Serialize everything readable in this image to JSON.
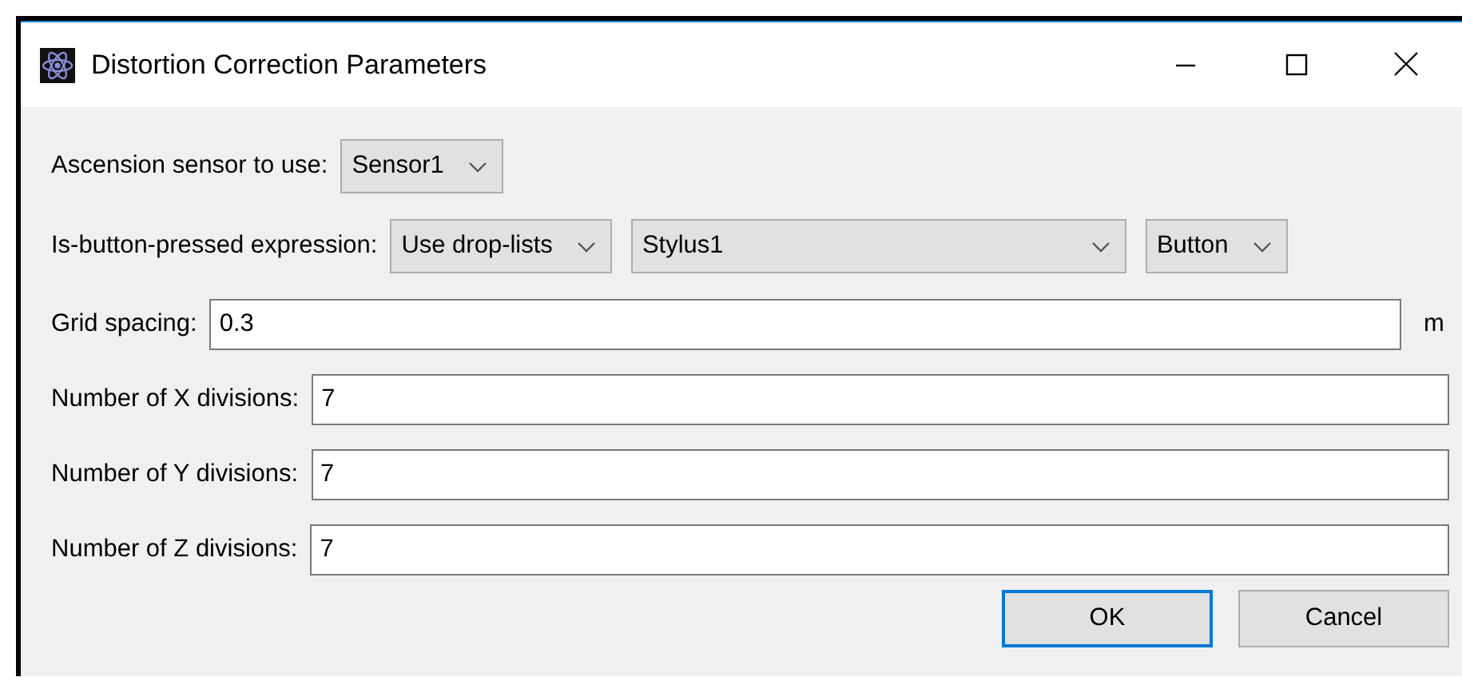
{
  "window": {
    "title": "Distortion Correction Parameters"
  },
  "rows": [
    {
      "label": "Ascension sensor to use:",
      "combos": [
        {
          "value": "Sensor1"
        }
      ]
    },
    {
      "label": "Is-button-pressed expression:",
      "combos": [
        {
          "value": "Use drop-lists"
        },
        {
          "value": "Stylus1"
        },
        {
          "value": "Button"
        }
      ]
    }
  ],
  "fields": [
    {
      "label": "Grid spacing:",
      "value": "0.3",
      "unit": "m"
    },
    {
      "label": "Number of X divisions:",
      "value": "7"
    },
    {
      "label": "Number of Y divisions:",
      "value": "7"
    },
    {
      "label": "Number of Z divisions:",
      "value": "7"
    }
  ],
  "buttons": [
    {
      "label": "OK",
      "default": true
    },
    {
      "label": "Cancel",
      "default": false
    }
  ]
}
